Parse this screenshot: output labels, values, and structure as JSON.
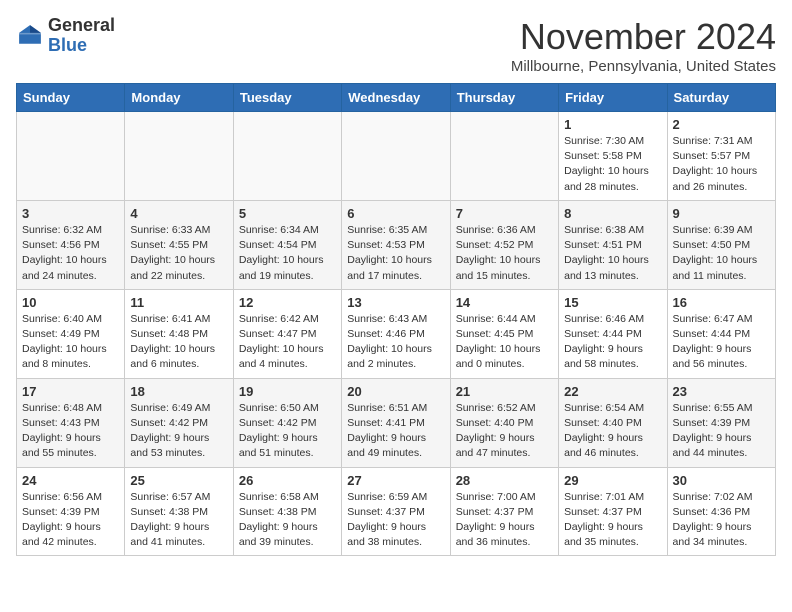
{
  "header": {
    "logo_line1": "General",
    "logo_line2": "Blue",
    "month_title": "November 2024",
    "location": "Millbourne, Pennsylvania, United States"
  },
  "days_of_week": [
    "Sunday",
    "Monday",
    "Tuesday",
    "Wednesday",
    "Thursday",
    "Friday",
    "Saturday"
  ],
  "weeks": [
    [
      {
        "day": "",
        "info": ""
      },
      {
        "day": "",
        "info": ""
      },
      {
        "day": "",
        "info": ""
      },
      {
        "day": "",
        "info": ""
      },
      {
        "day": "",
        "info": ""
      },
      {
        "day": "1",
        "info": "Sunrise: 7:30 AM\nSunset: 5:58 PM\nDaylight: 10 hours\nand 28 minutes."
      },
      {
        "day": "2",
        "info": "Sunrise: 7:31 AM\nSunset: 5:57 PM\nDaylight: 10 hours\nand 26 minutes."
      }
    ],
    [
      {
        "day": "3",
        "info": "Sunrise: 6:32 AM\nSunset: 4:56 PM\nDaylight: 10 hours\nand 24 minutes."
      },
      {
        "day": "4",
        "info": "Sunrise: 6:33 AM\nSunset: 4:55 PM\nDaylight: 10 hours\nand 22 minutes."
      },
      {
        "day": "5",
        "info": "Sunrise: 6:34 AM\nSunset: 4:54 PM\nDaylight: 10 hours\nand 19 minutes."
      },
      {
        "day": "6",
        "info": "Sunrise: 6:35 AM\nSunset: 4:53 PM\nDaylight: 10 hours\nand 17 minutes."
      },
      {
        "day": "7",
        "info": "Sunrise: 6:36 AM\nSunset: 4:52 PM\nDaylight: 10 hours\nand 15 minutes."
      },
      {
        "day": "8",
        "info": "Sunrise: 6:38 AM\nSunset: 4:51 PM\nDaylight: 10 hours\nand 13 minutes."
      },
      {
        "day": "9",
        "info": "Sunrise: 6:39 AM\nSunset: 4:50 PM\nDaylight: 10 hours\nand 11 minutes."
      }
    ],
    [
      {
        "day": "10",
        "info": "Sunrise: 6:40 AM\nSunset: 4:49 PM\nDaylight: 10 hours\nand 8 minutes."
      },
      {
        "day": "11",
        "info": "Sunrise: 6:41 AM\nSunset: 4:48 PM\nDaylight: 10 hours\nand 6 minutes."
      },
      {
        "day": "12",
        "info": "Sunrise: 6:42 AM\nSunset: 4:47 PM\nDaylight: 10 hours\nand 4 minutes."
      },
      {
        "day": "13",
        "info": "Sunrise: 6:43 AM\nSunset: 4:46 PM\nDaylight: 10 hours\nand 2 minutes."
      },
      {
        "day": "14",
        "info": "Sunrise: 6:44 AM\nSunset: 4:45 PM\nDaylight: 10 hours\nand 0 minutes."
      },
      {
        "day": "15",
        "info": "Sunrise: 6:46 AM\nSunset: 4:44 PM\nDaylight: 9 hours\nand 58 minutes."
      },
      {
        "day": "16",
        "info": "Sunrise: 6:47 AM\nSunset: 4:44 PM\nDaylight: 9 hours\nand 56 minutes."
      }
    ],
    [
      {
        "day": "17",
        "info": "Sunrise: 6:48 AM\nSunset: 4:43 PM\nDaylight: 9 hours\nand 55 minutes."
      },
      {
        "day": "18",
        "info": "Sunrise: 6:49 AM\nSunset: 4:42 PM\nDaylight: 9 hours\nand 53 minutes."
      },
      {
        "day": "19",
        "info": "Sunrise: 6:50 AM\nSunset: 4:42 PM\nDaylight: 9 hours\nand 51 minutes."
      },
      {
        "day": "20",
        "info": "Sunrise: 6:51 AM\nSunset: 4:41 PM\nDaylight: 9 hours\nand 49 minutes."
      },
      {
        "day": "21",
        "info": "Sunrise: 6:52 AM\nSunset: 4:40 PM\nDaylight: 9 hours\nand 47 minutes."
      },
      {
        "day": "22",
        "info": "Sunrise: 6:54 AM\nSunset: 4:40 PM\nDaylight: 9 hours\nand 46 minutes."
      },
      {
        "day": "23",
        "info": "Sunrise: 6:55 AM\nSunset: 4:39 PM\nDaylight: 9 hours\nand 44 minutes."
      }
    ],
    [
      {
        "day": "24",
        "info": "Sunrise: 6:56 AM\nSunset: 4:39 PM\nDaylight: 9 hours\nand 42 minutes."
      },
      {
        "day": "25",
        "info": "Sunrise: 6:57 AM\nSunset: 4:38 PM\nDaylight: 9 hours\nand 41 minutes."
      },
      {
        "day": "26",
        "info": "Sunrise: 6:58 AM\nSunset: 4:38 PM\nDaylight: 9 hours\nand 39 minutes."
      },
      {
        "day": "27",
        "info": "Sunrise: 6:59 AM\nSunset: 4:37 PM\nDaylight: 9 hours\nand 38 minutes."
      },
      {
        "day": "28",
        "info": "Sunrise: 7:00 AM\nSunset: 4:37 PM\nDaylight: 9 hours\nand 36 minutes."
      },
      {
        "day": "29",
        "info": "Sunrise: 7:01 AM\nSunset: 4:37 PM\nDaylight: 9 hours\nand 35 minutes."
      },
      {
        "day": "30",
        "info": "Sunrise: 7:02 AM\nSunset: 4:36 PM\nDaylight: 9 hours\nand 34 minutes."
      }
    ]
  ]
}
